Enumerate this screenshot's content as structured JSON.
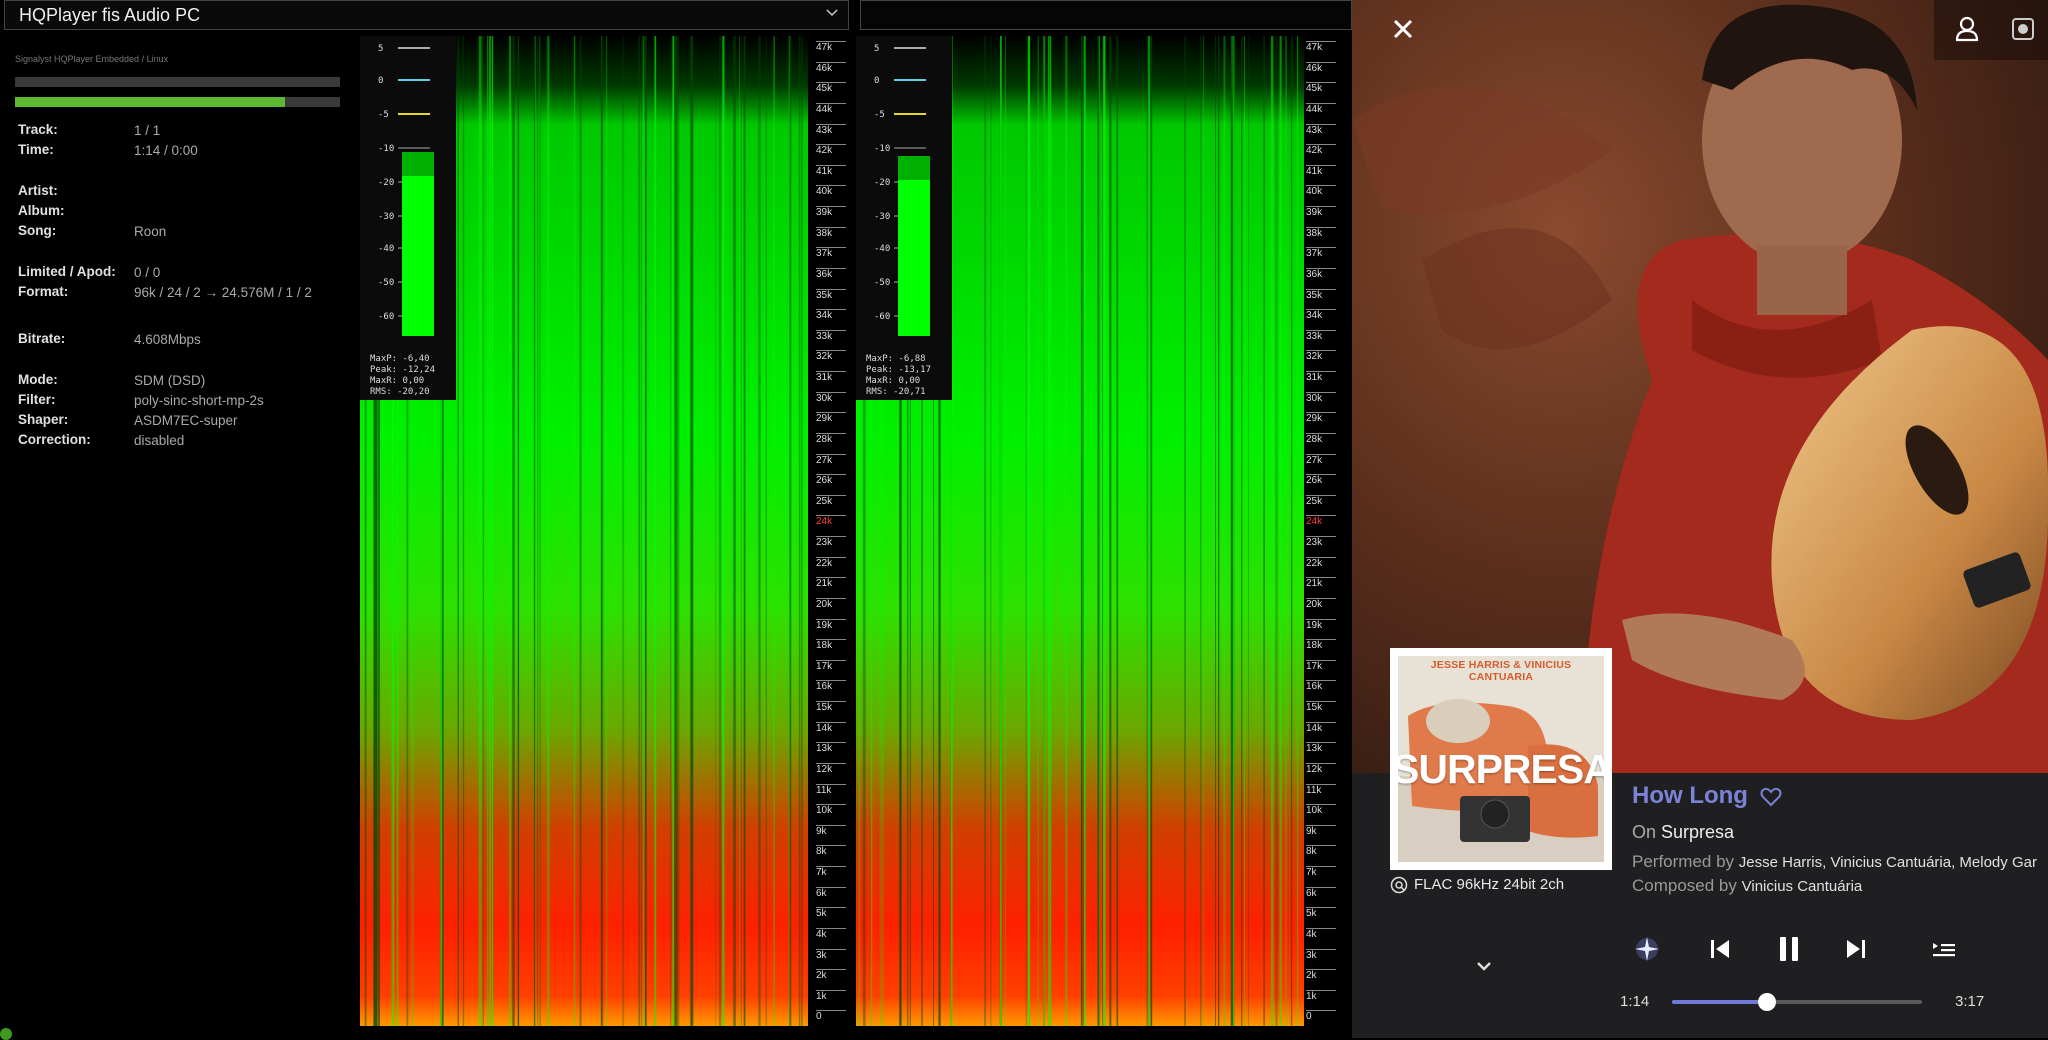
{
  "hqplayer": {
    "device_selector": "HQPlayer fis Audio PC",
    "engine_label": "Signalyst HQPlayer Embedded / Linux",
    "progress_buffer": 1.0,
    "progress_playback": 0.83,
    "info": [
      {
        "label": "Track:",
        "value": "1 / 1"
      },
      {
        "label": "Time:",
        "value": "1:14 / 0:00"
      },
      {
        "label": "Artist:",
        "value": ""
      },
      {
        "label": "Album:",
        "value": ""
      },
      {
        "label": "Song:",
        "value": "Roon"
      },
      {
        "label": "Limited / Apod:",
        "value": "0 / 0"
      },
      {
        "label": "Format:",
        "value": "96k / 24 / 2 → 24.576M / 1 / 2"
      },
      {
        "label": "Bitrate:",
        "value": "4.608Mbps"
      },
      {
        "label": "Mode:",
        "value": "SDM (DSD)"
      },
      {
        "label": "Filter:",
        "value": "poly-sinc-short-mp-2s"
      },
      {
        "label": "Shaper:",
        "value": "ASDM7EC-super"
      },
      {
        "label": "Correction:",
        "value": "disabled"
      }
    ]
  },
  "spectrum": {
    "freq_scale": [
      "47k",
      "46k",
      "45k",
      "44k",
      "43k",
      "42k",
      "41k",
      "40k",
      "39k",
      "38k",
      "37k",
      "36k",
      "35k",
      "34k",
      "33k",
      "32k",
      "31k",
      "30k",
      "29k",
      "28k",
      "27k",
      "26k",
      "25k",
      "24k",
      "23k",
      "22k",
      "21k",
      "20k",
      "19k",
      "18k",
      "17k",
      "16k",
      "15k",
      "14k",
      "13k",
      "12k",
      "11k",
      "10k",
      "9k",
      "8k",
      "7k",
      "6k",
      "5k",
      "4k",
      "3k",
      "2k",
      "1k",
      "0"
    ],
    "db_scale": [
      "5",
      "0",
      "-5",
      "-10",
      "-20",
      "-30",
      "-40",
      "-50",
      "-60"
    ],
    "left": {
      "maxp": "MaxP: -6,40",
      "peak": "Peak: -12,24",
      "maxr": "MaxR: 0,00",
      "rms": "RMS: -20,20"
    },
    "right": {
      "maxp": "MaxP: -6,88",
      "peak": "Peak: -13,17",
      "maxr": "MaxR: 0,00",
      "rms": "RMS: -20,71"
    }
  },
  "roon": {
    "album_cover_artists": "JESSE HARRIS & VINICIUS CANTUARIA",
    "album_cover_title": "SURPRESA",
    "format": "FLAC 96kHz 24bit 2ch",
    "song_title": "How Long",
    "on_prefix": "On",
    "album": "Surpresa",
    "performed_prefix": "Performed by",
    "performers": "Jesse Harris, Vinicius Cantuária, Melody Gar",
    "composed_prefix": "Composed by",
    "composers": "Vinicius Cantuária",
    "elapsed": "1:14",
    "total": "3:17",
    "progress": 0.38
  },
  "colors": {
    "accent": "#7b83d6",
    "hq_green": "#5fb832",
    "spectrum_high": "#00ff00",
    "spectrum_low": "#ff2000"
  }
}
